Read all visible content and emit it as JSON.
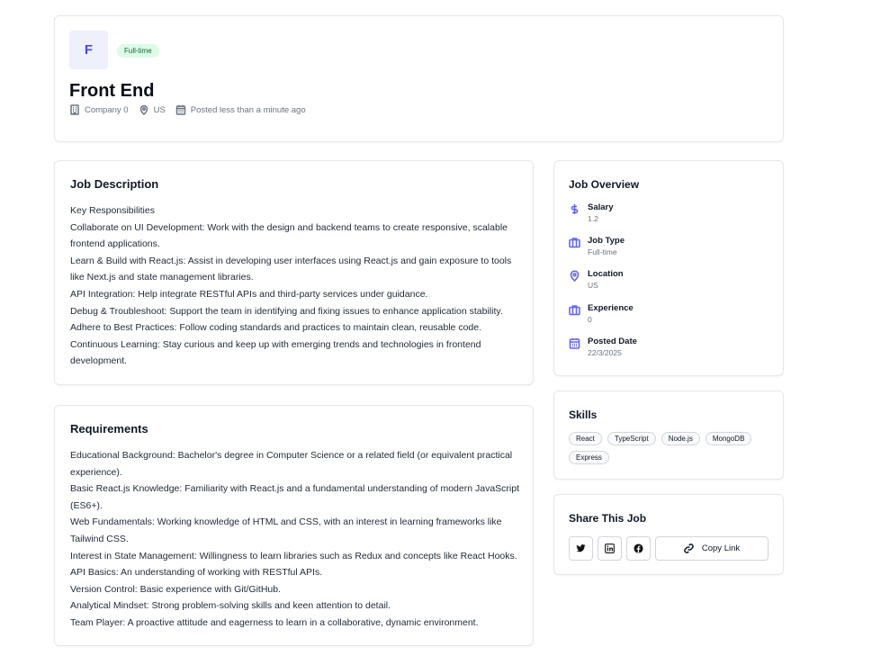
{
  "header": {
    "logo_letter": "F",
    "badge": "Full-time",
    "title": "Front End",
    "company": "Company 0",
    "location": "US",
    "posted": "Posted less than a minute ago"
  },
  "description": {
    "title": "Job Description",
    "lines": [
      "Key Responsibilities",
      "Collaborate on UI Development: Work with the design and backend teams to create responsive, scalable frontend applications.",
      "Learn & Build with React.js: Assist in developing user interfaces using React.js and gain exposure to tools like Next.js and state management libraries.",
      "API Integration: Help integrate RESTful APIs and third-party services under guidance.",
      "Debug & Troubleshoot: Support the team in identifying and fixing issues to enhance application stability.",
      "Adhere to Best Practices: Follow coding standards and practices to maintain clean, reusable code.",
      "Continuous Learning: Stay curious and keep up with emerging trends and technologies in frontend development."
    ]
  },
  "requirements": {
    "title": "Requirements",
    "lines": [
      "Educational Background: Bachelor's degree in Computer Science or a related field (or equivalent practical experience).",
      "Basic React.js Knowledge: Familiarity with React.js and a fundamental understanding of modern JavaScript (ES6+).",
      "Web Fundamentals: Working knowledge of HTML and CSS, with an interest in learning frameworks like Tailwind CSS.",
      "Interest in State Management: Willingness to learn libraries such as Redux and concepts like React Hooks.",
      "API Basics: An understanding of working with RESTful APIs.",
      "Version Control: Basic experience with Git/GitHub.",
      "Analytical Mindset: Strong problem-solving skills and keen attention to detail.",
      "Team Player: A proactive attitude and eagerness to learn in a collaborative, dynamic environment."
    ]
  },
  "overview": {
    "title": "Job Overview",
    "items": [
      {
        "label": "Salary",
        "value": "1.2",
        "icon": "dollar-icon"
      },
      {
        "label": "Job Type",
        "value": "Full-time",
        "icon": "briefcase-icon"
      },
      {
        "label": "Location",
        "value": "US",
        "icon": "map-pin-icon"
      },
      {
        "label": "Experience",
        "value": "0",
        "icon": "briefcase-icon"
      },
      {
        "label": "Posted Date",
        "value": "22/3/2025",
        "icon": "calendar-icon"
      }
    ]
  },
  "skills": {
    "title": "Skills",
    "items": [
      "React",
      "TypeScript",
      "Node.js",
      "MongoDB",
      "Express"
    ]
  },
  "share": {
    "title": "Share This Job",
    "copy_label": "Copy Link"
  },
  "colors": {
    "accent": "#6366f1",
    "badge_bg": "#dcfce7",
    "badge_text": "#166534"
  }
}
